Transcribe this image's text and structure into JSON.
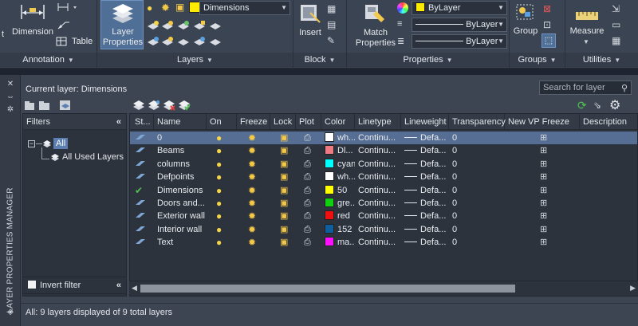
{
  "ribbon": {
    "annotation": {
      "title": "Annotation",
      "dimension_label": "Dimension",
      "table_label": "Table"
    },
    "layers": {
      "title": "Layers",
      "layer_properties_label": "Layer\nProperties",
      "current_layer": "Dimensions",
      "current_color": "#ffeb00"
    },
    "block": {
      "title": "Block",
      "insert_label": "Insert"
    },
    "properties": {
      "title": "Properties",
      "match_label": "Match\nProperties",
      "color_value": "ByLayer",
      "linetype_value": "ByLayer",
      "lineweight_value": "ByLayer"
    },
    "groups": {
      "title": "Groups",
      "group_label": "Group"
    },
    "utilities": {
      "title": "Utilities",
      "measure_label": "Measure"
    }
  },
  "palette": {
    "side_title": "LAYER PROPERTIES MANAGER",
    "current_layer_text": "Current layer: Dimensions",
    "search_placeholder": "Search for layer",
    "filters_header": "Filters",
    "filter_all": "All",
    "filter_used": "All Used Layers",
    "invert_filter": "Invert filter",
    "status": "All: 9 layers displayed of 9 total layers",
    "columns": [
      "St...",
      "Name",
      "On",
      "Freeze",
      "Lock",
      "Plot",
      "Color",
      "Linetype",
      "Lineweight",
      "Transparency",
      "New VP Freeze",
      "Description"
    ],
    "layers": [
      {
        "status": "layer",
        "name": "0",
        "color_name": "wh...",
        "color": "#ffffff",
        "linetype": "Continu...",
        "lineweight": "Defa...",
        "transparency": "0",
        "selected": true
      },
      {
        "status": "layer",
        "name": "Beams",
        "color_name": "Dl...",
        "color": "#f07a84",
        "linetype": "Continu...",
        "lineweight": "Defa...",
        "transparency": "0"
      },
      {
        "status": "layer",
        "name": "columns",
        "color_name": "cyan",
        "color": "#00ffff",
        "linetype": "Continu...",
        "lineweight": "Defa...",
        "transparency": "0"
      },
      {
        "status": "layer",
        "name": "Defpoints",
        "color_name": "wh...",
        "color": "#ffffff",
        "linetype": "Continu...",
        "lineweight": "Defa...",
        "transparency": "0"
      },
      {
        "status": "current",
        "name": "Dimensions",
        "color_name": "50",
        "color": "#ffff00",
        "linetype": "Continu...",
        "lineweight": "Defa...",
        "transparency": "0"
      },
      {
        "status": "layer",
        "name": "Doors and...",
        "color_name": "gre...",
        "color": "#10d010",
        "linetype": "Continu...",
        "lineweight": "Defa...",
        "transparency": "0"
      },
      {
        "status": "layer",
        "name": "Exterior wall",
        "color_name": "red",
        "color": "#ee1010",
        "linetype": "Continu...",
        "lineweight": "Defa...",
        "transparency": "0"
      },
      {
        "status": "layer",
        "name": "Interior wall",
        "color_name": "152",
        "color": "#0f5f9f",
        "linetype": "Continu...",
        "lineweight": "Defa...",
        "transparency": "0"
      },
      {
        "status": "layer",
        "name": "Text",
        "color_name": "ma...",
        "color": "#ff10ff",
        "linetype": "Continu...",
        "lineweight": "Defa...",
        "transparency": "0"
      }
    ]
  }
}
